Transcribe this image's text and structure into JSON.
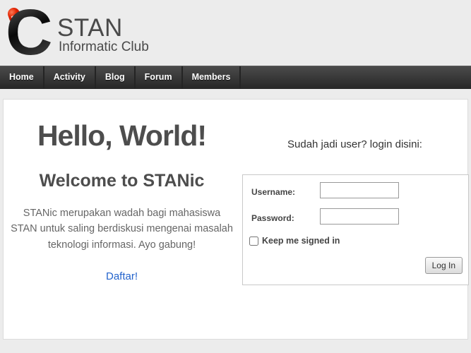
{
  "brand": {
    "logo_letter": "C",
    "name": "STAN",
    "tagline": "Informatic Club"
  },
  "nav": {
    "items": [
      {
        "label": "Home"
      },
      {
        "label": "Activity"
      },
      {
        "label": "Blog"
      },
      {
        "label": "Forum"
      },
      {
        "label": "Members"
      }
    ]
  },
  "hero": {
    "heading": "Hello, World!",
    "subheading": "Welcome to STANic",
    "description": "STANic merupakan wadah bagi mahasiswa STAN untuk saling berdiskusi mengenai masalah teknologi informasi. Ayo gabung!",
    "register_link_label": "Daftar!"
  },
  "login": {
    "prompt": "Sudah jadi user? login disini:",
    "username": {
      "label": "Username:",
      "value": "",
      "placeholder": ""
    },
    "password": {
      "label": "Password:",
      "value": "",
      "placeholder": ""
    },
    "remember": {
      "label": "Keep me signed in",
      "checked": false
    },
    "submit_label": "Log In"
  },
  "colors": {
    "page_bg": "#ececec",
    "nav_bg_top": "#4b4b4b",
    "nav_bg_bottom": "#262626",
    "heading_text": "#4d4d4d",
    "body_text": "#666666",
    "link_blue": "#2363cc",
    "logo_red": "#d41500",
    "logo_black": "#161616"
  }
}
